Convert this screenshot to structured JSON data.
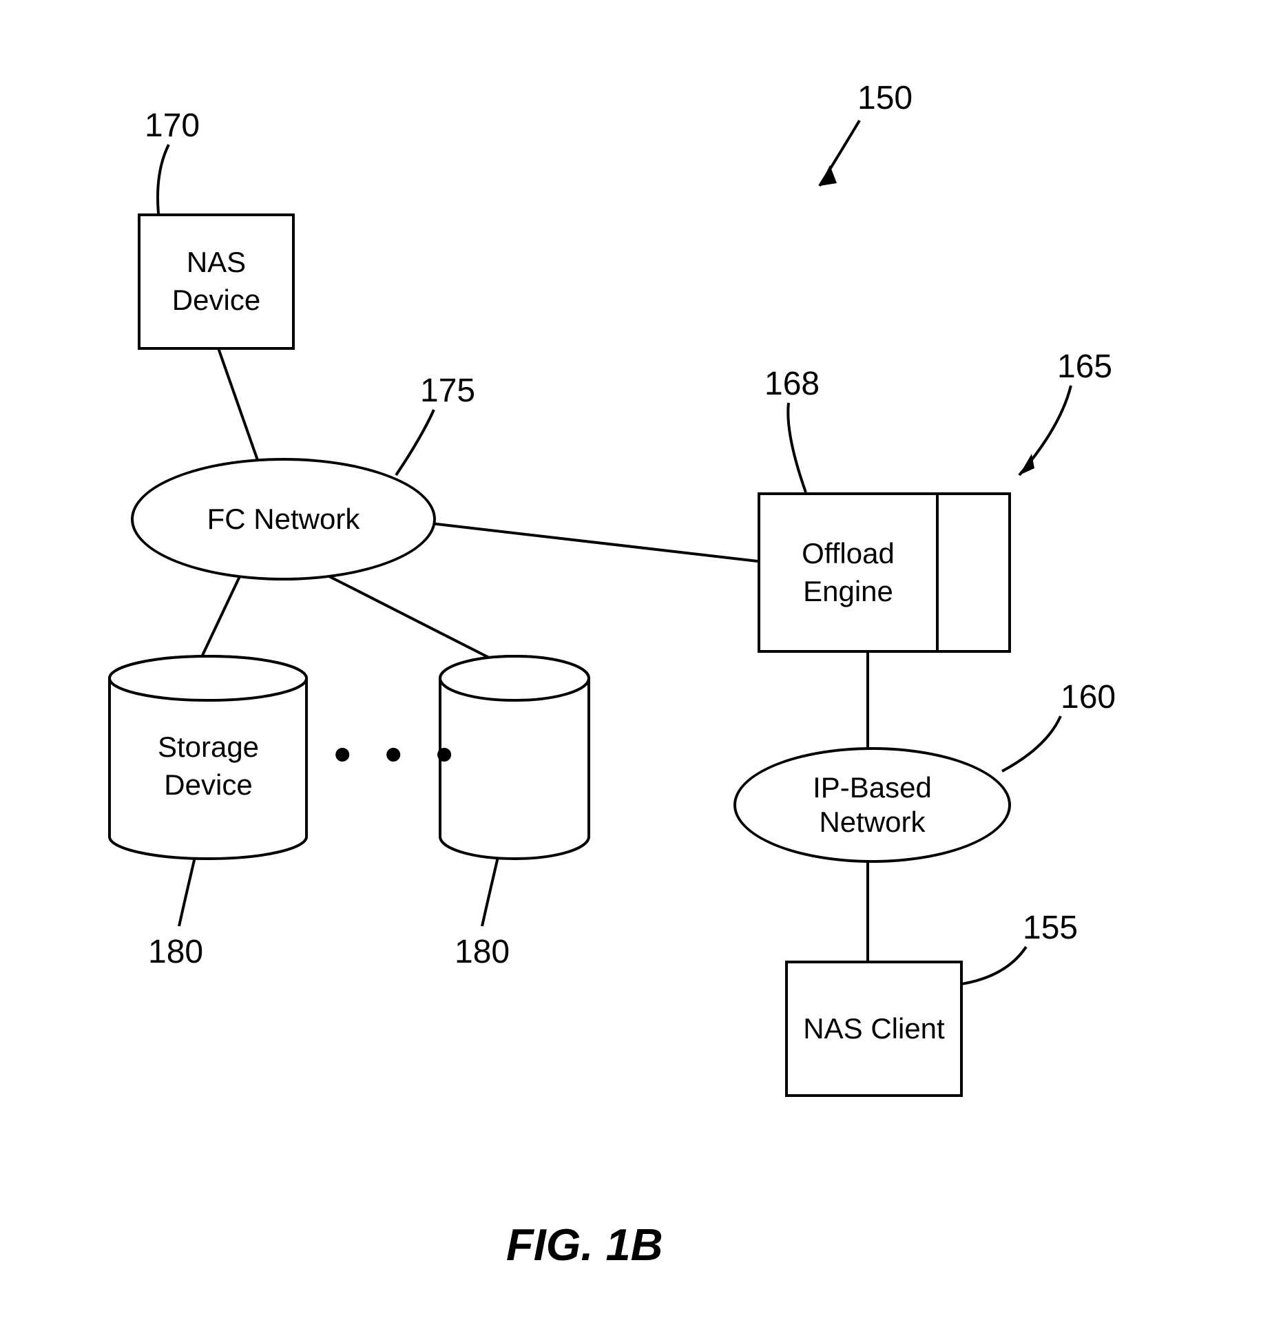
{
  "figure": {
    "title": "FIG. 1B"
  },
  "nodes": {
    "nas_device": {
      "label": "NAS\nDevice",
      "ref": "170"
    },
    "fc_network": {
      "label": "FC Network",
      "ref": "175"
    },
    "offload_engine": {
      "label": "Offload\nEngine",
      "ref_inner": "168",
      "ref_outer": "165"
    },
    "ip_network": {
      "label": "IP-Based\nNetwork",
      "ref": "160"
    },
    "nas_client": {
      "label": "NAS Client",
      "ref": "155"
    },
    "storage_device_left": {
      "label": "Storage\nDevice",
      "ref": "180"
    },
    "storage_device_right": {
      "label": "",
      "ref": "180"
    },
    "overall": {
      "ref": "150"
    }
  },
  "misc": {
    "ellipsis": "• • •"
  }
}
